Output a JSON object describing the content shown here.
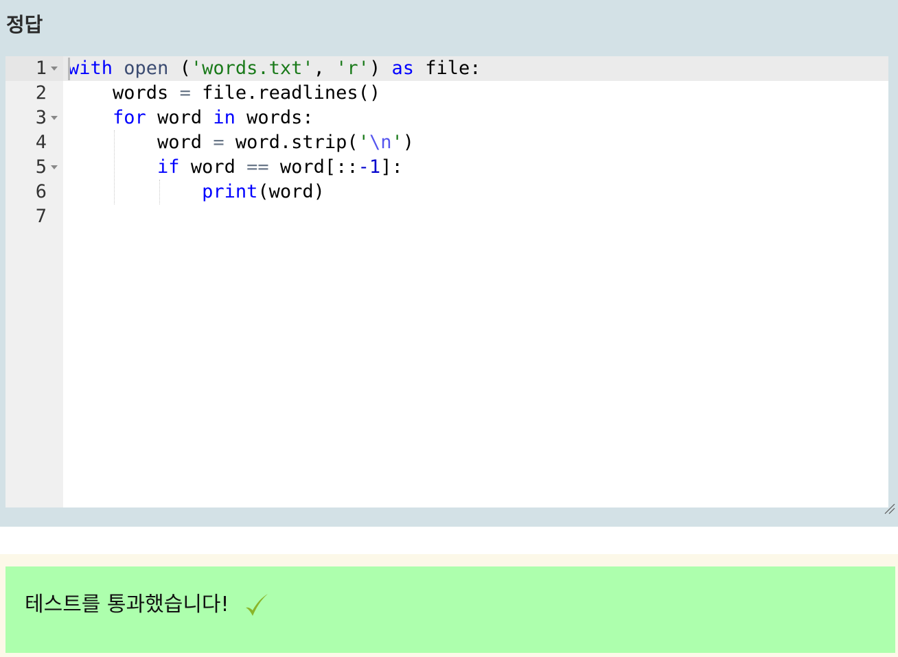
{
  "answer": {
    "title": "정답"
  },
  "editor": {
    "line_numbers": [
      "1",
      "2",
      "3",
      "4",
      "5",
      "6",
      "7"
    ],
    "foldable_lines": [
      1,
      3,
      5
    ],
    "lines": [
      [
        {
          "t": "with",
          "c": "kw"
        },
        {
          "t": " "
        },
        {
          "t": "open",
          "c": "fn"
        },
        {
          "t": " ("
        },
        {
          "t": "'words.txt'",
          "c": "str"
        },
        {
          "t": ", "
        },
        {
          "t": "'r'",
          "c": "str"
        },
        {
          "t": ") "
        },
        {
          "t": "as",
          "c": "kw"
        },
        {
          "t": " file:"
        }
      ],
      [
        {
          "t": "    words "
        },
        {
          "t": "=",
          "c": "op"
        },
        {
          "t": " file.readlines()"
        }
      ],
      [
        {
          "t": "    "
        },
        {
          "t": "for",
          "c": "kw"
        },
        {
          "t": " word "
        },
        {
          "t": "in",
          "c": "kw"
        },
        {
          "t": " words:"
        }
      ],
      [
        {
          "t": "        word "
        },
        {
          "t": "=",
          "c": "op"
        },
        {
          "t": " word.strip("
        },
        {
          "t": "'",
          "c": "str"
        },
        {
          "t": "\\n",
          "c": "esc"
        },
        {
          "t": "'",
          "c": "str"
        },
        {
          "t": ")"
        }
      ],
      [
        {
          "t": "        "
        },
        {
          "t": "if",
          "c": "kw"
        },
        {
          "t": " word "
        },
        {
          "t": "==",
          "c": "op"
        },
        {
          "t": " word[::"
        },
        {
          "t": "-1",
          "c": "num"
        },
        {
          "t": "]:"
        }
      ],
      [
        {
          "t": "            "
        },
        {
          "t": "print",
          "c": "kw"
        },
        {
          "t": "(word)"
        }
      ],
      []
    ]
  },
  "result": {
    "message": "테스트를 통과했습니다!"
  },
  "colors": {
    "panel_bg": "#d3e1e6",
    "success_bg": "#adffad",
    "check": "#8ab52a"
  }
}
